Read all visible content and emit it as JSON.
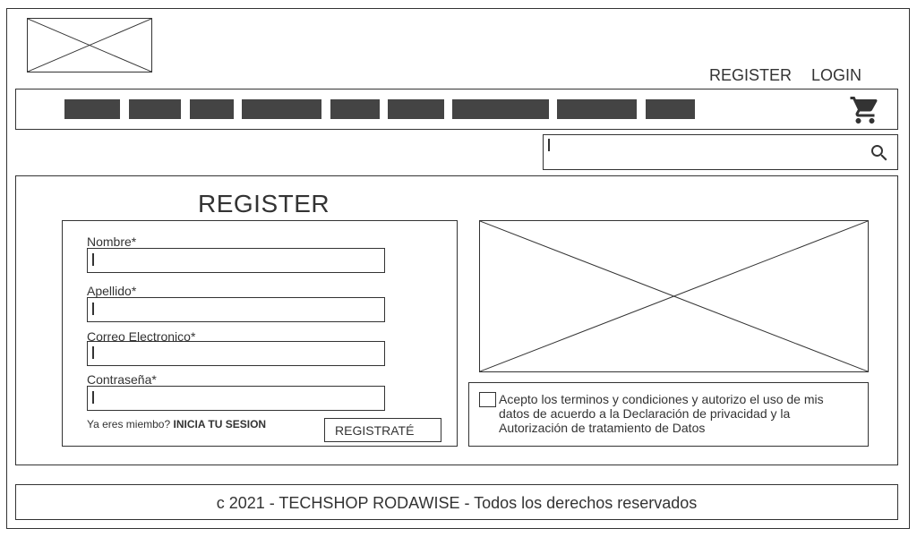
{
  "header": {
    "register_link": "REGISTER",
    "login_link": "LOGIN",
    "logo_icon": "image-placeholder-icon"
  },
  "navbar": {
    "items": [
      "",
      "",
      "",
      "",
      "",
      "",
      "",
      "",
      ""
    ],
    "cart_icon": "cart-icon",
    "block_color": "#444444"
  },
  "search": {
    "value": "",
    "icon": "search-icon"
  },
  "register": {
    "title": "REGISTER",
    "fields": [
      {
        "label": "Nombre*",
        "value": ""
      },
      {
        "label": "Apellido*",
        "value": ""
      },
      {
        "label": "Correo Electronico*",
        "value": ""
      },
      {
        "label": "Contraseña*",
        "value": ""
      }
    ],
    "already_member_text": "Ya eres miembo?",
    "login_link": "INICIA TU SESION",
    "submit_label": "REGISTRATÉ",
    "image_icon": "image-placeholder-icon"
  },
  "terms": {
    "checked": false,
    "text": "Acepto los terminos y condiciones y autorizo el uso de mis datos de acuerdo a la Declaración de privacidad y la Autorización de tratamiento de Datos"
  },
  "footer": {
    "text": "c 2021 - TECHSHOP RODAWISE - Todos los derechos reservados"
  },
  "colors": {
    "line": "#333333",
    "background": "#ffffff"
  }
}
